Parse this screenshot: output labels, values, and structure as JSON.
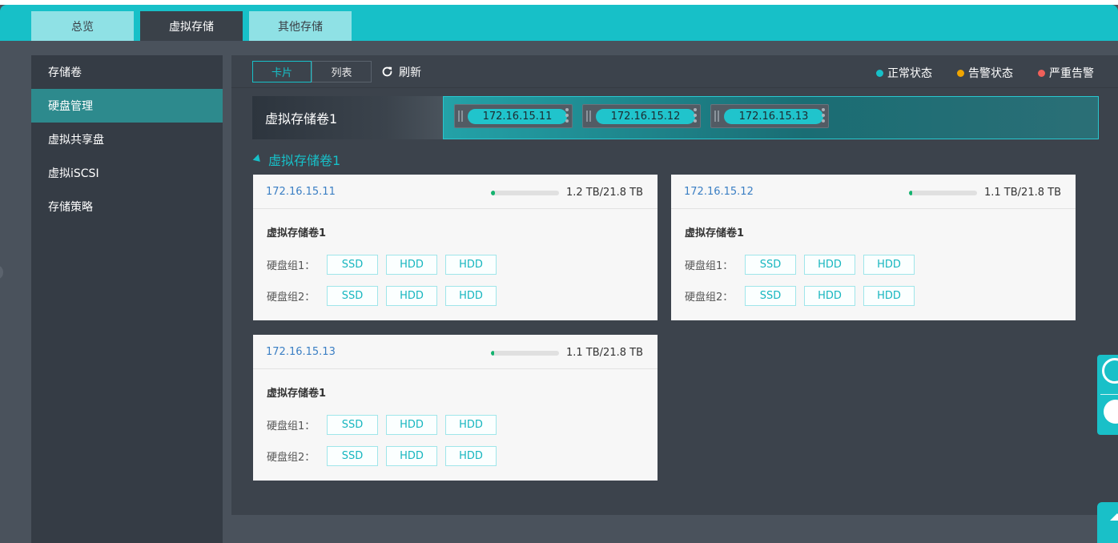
{
  "top_tabs": [
    "总览",
    "虚拟存储",
    "其他存储"
  ],
  "active_top_tab": "虚拟存储",
  "sidebar": {
    "items": [
      "存储卷",
      "硬盘管理",
      "虚拟共享盘",
      "虚拟iSCSI",
      "存储策略"
    ],
    "active": "硬盘管理"
  },
  "toolbar": {
    "view_card": "卡片",
    "view_list": "列表",
    "refresh_label": "刷新",
    "legend": [
      {
        "label": "正常状态",
        "color": "#17c0c8"
      },
      {
        "label": "告警状态",
        "color": "#f0a500"
      },
      {
        "label": "严重告警",
        "color": "#f0605a"
      }
    ]
  },
  "volume_strip": {
    "name": "虚拟存储卷1",
    "servers": [
      "172.16.15.11",
      "172.16.15.12",
      "172.16.15.13"
    ]
  },
  "section_title": "虚拟存储卷1",
  "cards": [
    {
      "ip": "172.16.15.11",
      "usage_text": "1.2 TB/21.8 TB",
      "usage_fraction": 0.055,
      "volume": "虚拟存储卷1",
      "groups": [
        {
          "label": "硬盘组1：",
          "disks": [
            "SSD",
            "HDD",
            "HDD"
          ]
        },
        {
          "label": "硬盘组2：",
          "disks": [
            "SSD",
            "HDD",
            "HDD"
          ]
        }
      ]
    },
    {
      "ip": "172.16.15.12",
      "usage_text": "1.1 TB/21.8 TB",
      "usage_fraction": 0.05,
      "volume": "虚拟存储卷1",
      "groups": [
        {
          "label": "硬盘组1：",
          "disks": [
            "SSD",
            "HDD",
            "HDD"
          ]
        },
        {
          "label": "硬盘组2：",
          "disks": [
            "SSD",
            "HDD",
            "HDD"
          ]
        }
      ]
    },
    {
      "ip": "172.16.15.13",
      "usage_text": "1.1 TB/21.8 TB",
      "usage_fraction": 0.05,
      "volume": "虚拟存储卷1",
      "groups": [
        {
          "label": "硬盘组1：",
          "disks": [
            "SSD",
            "HDD",
            "HDD"
          ]
        },
        {
          "label": "硬盘组2：",
          "disks": [
            "SSD",
            "HDD",
            "HDD"
          ]
        }
      ]
    }
  ],
  "icons": {
    "refresh": "refresh-icon",
    "collapse": "caret-down-icon",
    "service": "customer-service-icon",
    "back_to_top": "arrow-up-icon"
  }
}
